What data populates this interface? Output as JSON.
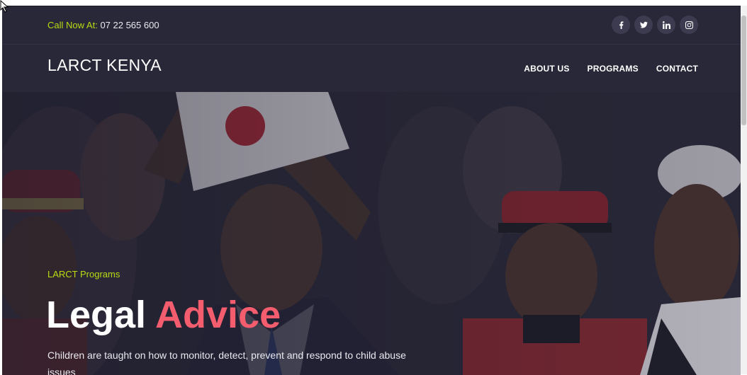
{
  "topbar": {
    "call_label": "Call Now At:",
    "phone": "07 22 565 600",
    "socials": [
      {
        "icon": "facebook-icon"
      },
      {
        "icon": "twitter-icon"
      },
      {
        "icon": "linkedin-icon"
      },
      {
        "icon": "instagram-icon"
      }
    ]
  },
  "navbar": {
    "brand": "LARCT KENYA",
    "menu": [
      {
        "label": "ABOUT US"
      },
      {
        "label": "PROGRAMS"
      },
      {
        "label": "CONTACT"
      }
    ]
  },
  "hero": {
    "subtitle": "LARCT Programs",
    "title_main": "Legal",
    "title_accent": "Advice",
    "description": "Children are taught on how to monitor, detect, prevent and respond to child abuse issues"
  },
  "colors": {
    "background": "#292838",
    "accent_green": "#b8dc12",
    "accent_pink": "#f45d6e",
    "text": "#ffffff"
  }
}
